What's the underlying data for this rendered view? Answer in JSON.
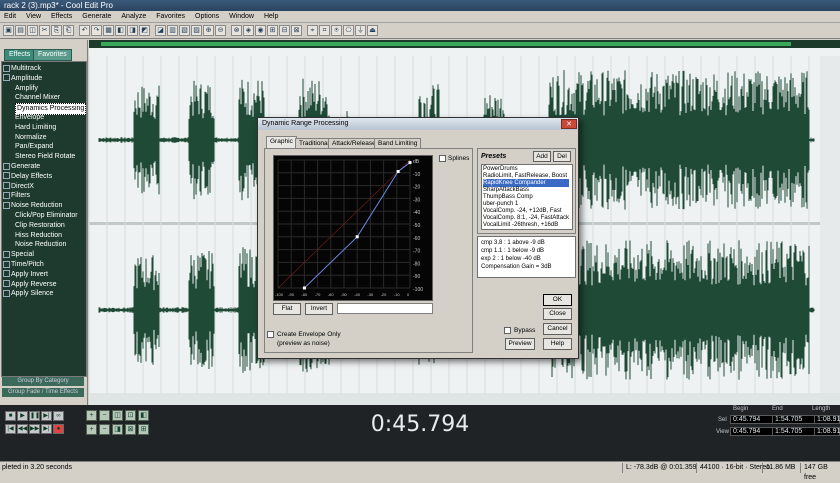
{
  "window": {
    "title": "rack 2 (3).mp3* - Cool Edit Pro"
  },
  "menu": [
    "Edit",
    "View",
    "Effects",
    "Generate",
    "Analyze",
    "Favorites",
    "Options",
    "Window",
    "Help"
  ],
  "left_panel": {
    "tabs": [
      "Effects",
      "Favorites"
    ],
    "items": [
      {
        "label": "Multitrack",
        "level": 0
      },
      {
        "label": "Amplitude",
        "level": 0
      },
      {
        "label": "Amplify",
        "level": 1
      },
      {
        "label": "Channel Mixer",
        "level": 1
      },
      {
        "label": "Dynamics Processing",
        "level": 1,
        "selected": true
      },
      {
        "label": "Envelope",
        "level": 1
      },
      {
        "label": "Hard Limiting",
        "level": 1
      },
      {
        "label": "Normalize",
        "level": 1
      },
      {
        "label": "Pan/Expand",
        "level": 1
      },
      {
        "label": "Stereo Field Rotate",
        "level": 1
      },
      {
        "label": "Generate",
        "level": 0
      },
      {
        "label": "Delay Effects",
        "level": 0
      },
      {
        "label": "DirectX",
        "level": 0
      },
      {
        "label": "Filters",
        "level": 0
      },
      {
        "label": "Noise Reduction",
        "level": 0
      },
      {
        "label": "Click/Pop Eliminator",
        "level": 1
      },
      {
        "label": "Clip Restoration",
        "level": 1
      },
      {
        "label": "Hiss Reduction",
        "level": 1
      },
      {
        "label": "Noise Reduction",
        "level": 1
      },
      {
        "label": "Special",
        "level": 0
      },
      {
        "label": "Time/Pitch",
        "level": 0
      },
      {
        "label": "Apply Invert",
        "level": 0
      },
      {
        "label": "Apply Reverse",
        "level": 0
      },
      {
        "label": "Apply Silence",
        "level": 0
      }
    ],
    "group_by_category": "Group By Category",
    "group_bottom": "Group Fade / Time Effects"
  },
  "dialog": {
    "title": "Dynamic Range Processing",
    "tabs": [
      "Graphic",
      "Traditional",
      "Attack/Release",
      "Band Limiting"
    ],
    "active_tab": "Graphic",
    "splines_label": "Splines",
    "db_scale": [
      "dB",
      "-10",
      "-20",
      "-30",
      "-40",
      "-50",
      "-60",
      "-70",
      "-80",
      "-90",
      "-100"
    ],
    "x_ticks": [
      "-100",
      "-90",
      "-80",
      "-70",
      "-60",
      "-50",
      "-40",
      "-30",
      "-20",
      "-10",
      "0"
    ],
    "flat_label": "Flat",
    "invert_label": "Invert",
    "create_env_label": "Create Envelope Only",
    "create_env_sub": "(preview as noise)",
    "presets_title": "Presets",
    "add_label": "Add",
    "del_label": "Del",
    "presets": [
      "PowerDrums",
      "RadioLimit, FastRelease, Boost",
      "RapidKnee Compander",
      "SharpAttackBass",
      "ThumpBass Comp",
      "uber-punch 1",
      "VocalComp. -24, +12dB, Fast",
      "VocalComp. 8:1, -24, FastAttack",
      "VocalLimit -26thresh, +16dB"
    ],
    "selected_preset": 2,
    "info_lines": [
      "cmp   3.8 : 1      above  -9 dB",
      "cmp   1.1 : 1      below  -9 dB",
      "exp   2 : 1         below  -40 dB",
      "Compensation Gain = 3dB"
    ],
    "ok_label": "OK",
    "close_label": "Close",
    "cancel_label": "Cancel",
    "bypass_label": "Bypass",
    "preview_label": "Preview",
    "help_label": "Help"
  },
  "transport": {
    "time": "0:45.794",
    "begin_label": "Begin",
    "end_label": "End",
    "length_label": "Length",
    "sel_label": "Sel",
    "view_label": "View",
    "sel_begin": "0:45.794",
    "sel_end": "1:54.705",
    "sel_length": "1:08.911",
    "view_begin": "0:45.794",
    "view_end": "1:54.705",
    "view_length": "1:08.911"
  },
  "status": {
    "left": "pleted in 3.20 seconds",
    "level": "L: -78.3dB @ 0:01.359",
    "rate": "44100 · 16-bit · Stereo",
    "size": "11.86 MB",
    "free": "147 GB free"
  }
}
